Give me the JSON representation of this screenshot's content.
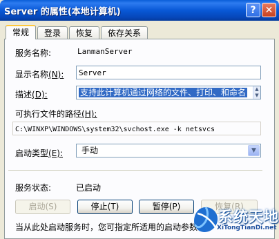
{
  "window": {
    "title": "Server 的属性(本地计算机)",
    "help_label": "?",
    "close_label": "✕"
  },
  "tabs": [
    {
      "label": "常规",
      "active": true
    },
    {
      "label": "登录",
      "active": false
    },
    {
      "label": "恢复",
      "active": false
    },
    {
      "label": "依存关系",
      "active": false
    }
  ],
  "general": {
    "service_name_label": "服务名称:",
    "service_name_value": "LanmanServer",
    "display_name_label": "显示名称",
    "display_name_accel": "(N):",
    "display_name_value": "Server",
    "description_label": "描述",
    "description_accel": "(D):",
    "description_value": "支持此计算机通过网络的文件、打印、和命名",
    "exe_path_label": "可执行文件的路径",
    "exe_path_accel": "(H):",
    "exe_path_value": "C:\\WINXP\\WINDOWS\\system32\\svchost.exe -k netsvcs",
    "startup_type_label": "启动类型",
    "startup_type_accel": "(E):",
    "startup_type_value": "手动",
    "status_label": "服务状态:",
    "status_value": "已启动",
    "buttons": {
      "start": "启动(S)",
      "stop": "停止(T)",
      "pause": "暂停(P)",
      "resume": "恢复(R)"
    },
    "hint_text": "当从此处启动服务时，您可指定所适用的启动参数"
  },
  "watermark": {
    "text_main": "系统天地",
    "text_sub": "XiTongTianDi.net"
  }
}
